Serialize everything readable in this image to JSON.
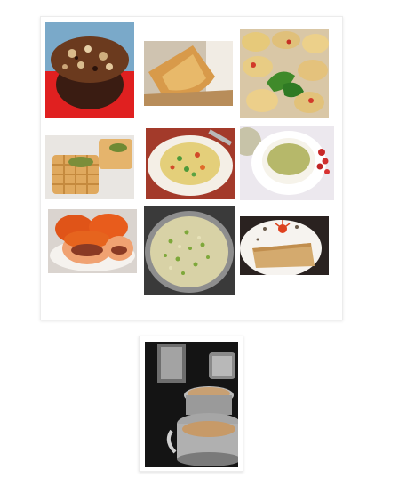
{
  "gallery": {
    "items": [
      {
        "name": "chocolate-nut-muffin"
      },
      {
        "name": "samosa-pastry"
      },
      {
        "name": "veggie-egg-muffins"
      },
      {
        "name": "stuffed-waffles"
      },
      {
        "name": "vegetable-rice-plate"
      },
      {
        "name": "green-chutney-bowl"
      },
      {
        "name": "stuffed-buns"
      },
      {
        "name": "vegetable-upma-pot"
      },
      {
        "name": "dosa-plate"
      }
    ]
  },
  "featured": {
    "name": "filter-coffee-tumblers"
  }
}
